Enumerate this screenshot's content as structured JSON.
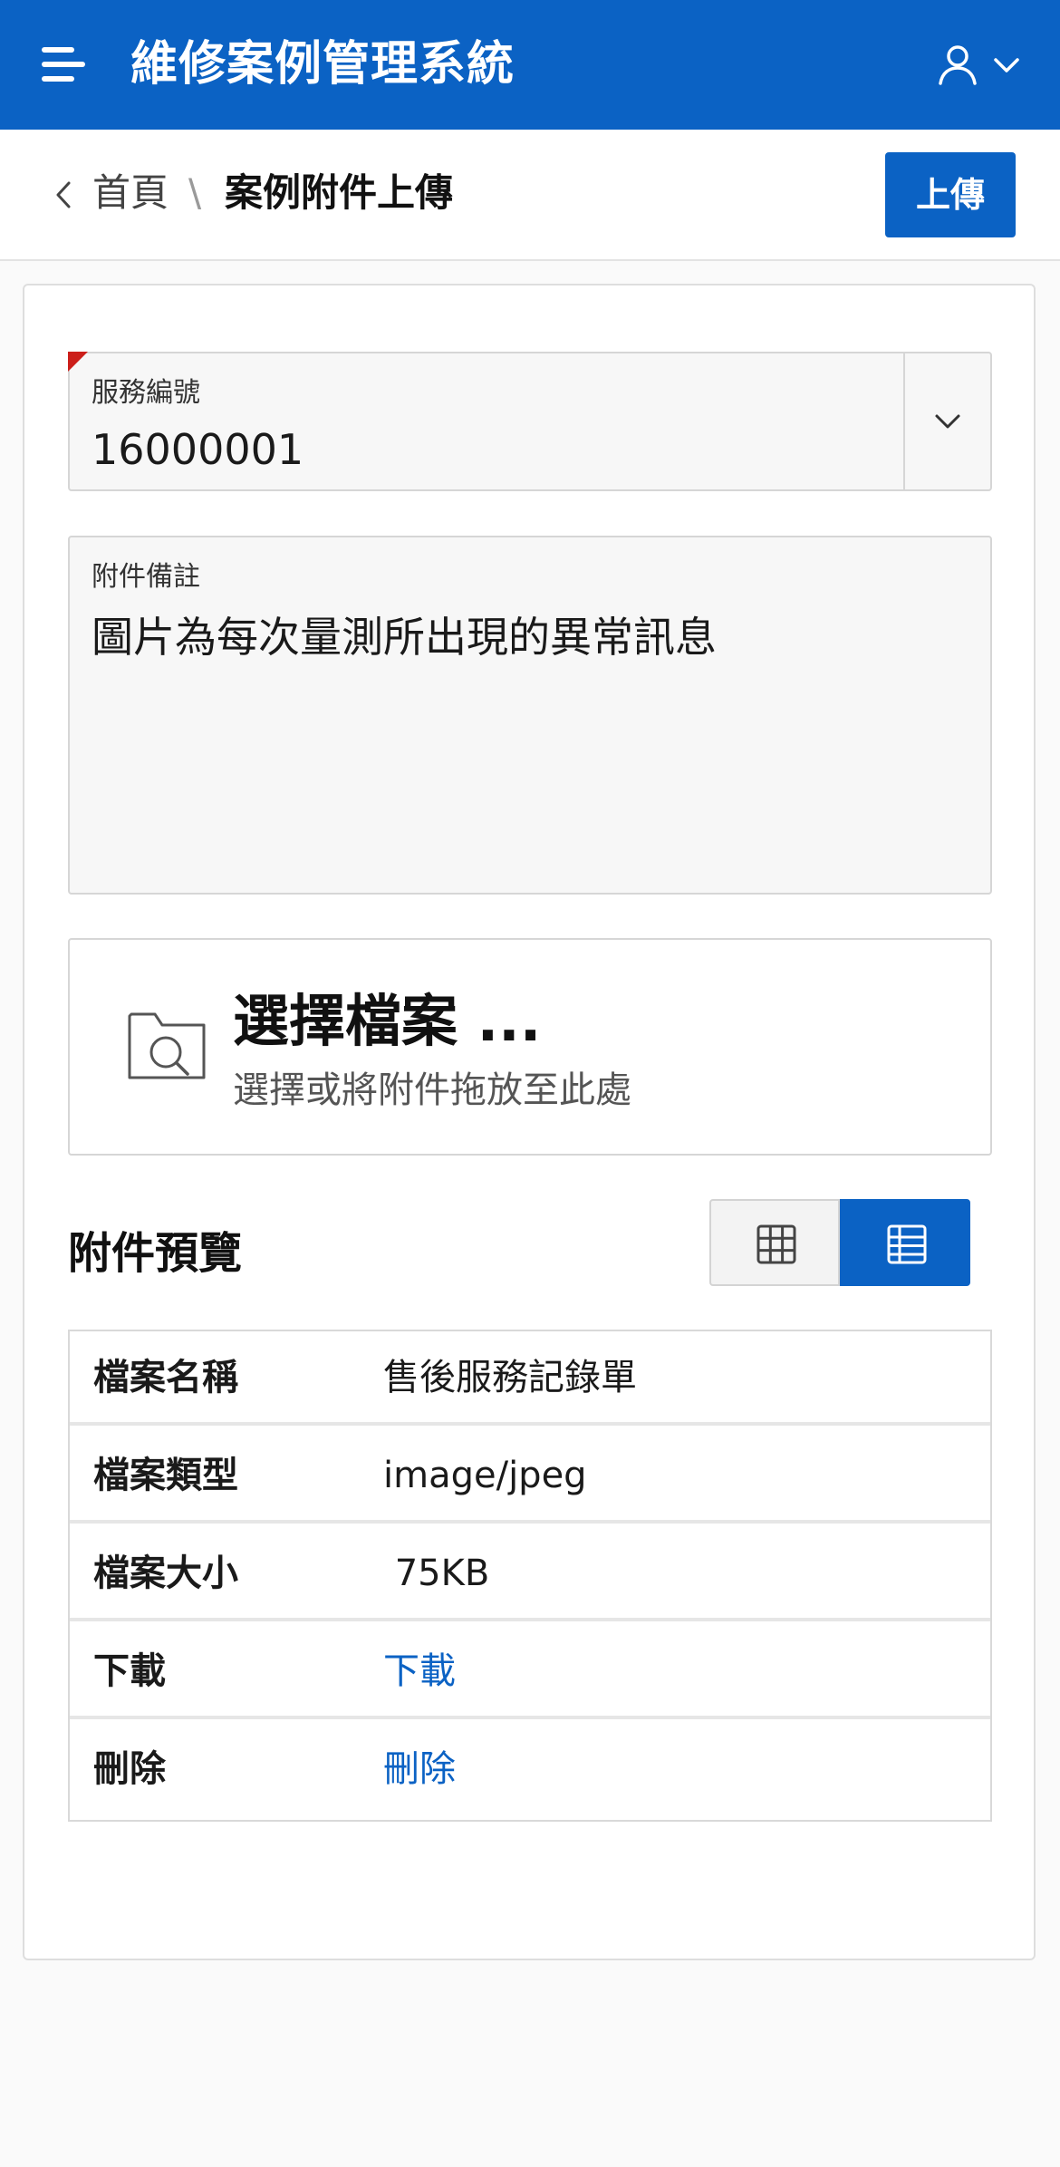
{
  "header": {
    "title": "維修案例管理系統",
    "menu_icon": "hamburger-menu-icon",
    "user_icon": "user-icon"
  },
  "breadcrumb": {
    "home": "首頁",
    "separator": "\\",
    "current": "案例附件上傳"
  },
  "toolbar": {
    "upload_label": "上傳"
  },
  "form": {
    "service_no": {
      "label": "服務編號",
      "value": "16000001",
      "required": true
    },
    "remark": {
      "label": "附件備註",
      "value": "圖片為每次量測所出現的異常訊息"
    },
    "dropzone": {
      "title": "選擇檔案 ...",
      "subtitle": "選擇或將附件拖放至此處",
      "icon": "folder-search-icon"
    }
  },
  "preview": {
    "title": "附件預覽",
    "view_mode": "table",
    "rows": [
      {
        "key": "檔案名稱",
        "value": "售後服務記錄單"
      },
      {
        "key": "檔案類型",
        "value": "image/jpeg"
      },
      {
        "key": "檔案大小",
        "value": " 75KB"
      },
      {
        "key": "下載",
        "value": "下載",
        "link": true
      },
      {
        "key": "刪除",
        "value": "刪除",
        "link": true
      }
    ]
  },
  "colors": {
    "brand": "#0b62c4",
    "required_flag": "#cc1f1a",
    "link": "#0b62c4"
  }
}
